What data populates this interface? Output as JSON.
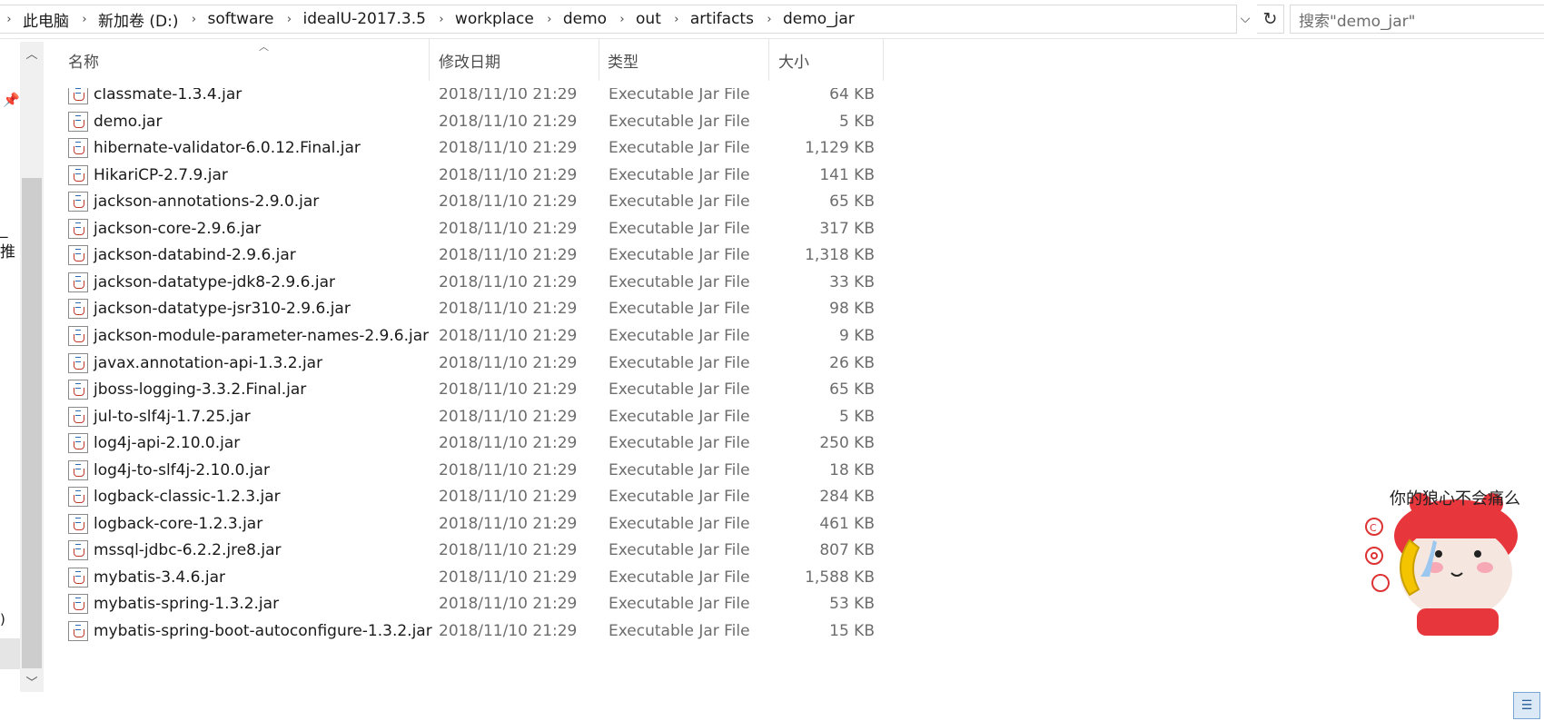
{
  "address": {
    "crumbs": [
      "此电脑",
      "新加卷 (D:)",
      "software",
      "idealU-2017.3.5",
      "workplace",
      "demo",
      "out",
      "artifacts",
      "demo_jar"
    ],
    "separator_icon": "chevron-right-icon"
  },
  "search": {
    "placeholder": "搜索\"demo_jar\""
  },
  "nav": {
    "fragment1": "_推",
    "fragment2": ")"
  },
  "columns": {
    "name": "名称",
    "date": "修改日期",
    "type": "类型",
    "size": "大小"
  },
  "files": [
    {
      "name": "classmate-1.3.4.jar",
      "date": "2018/11/10 21:29",
      "type": "Executable Jar File",
      "size": "64 KB"
    },
    {
      "name": "demo.jar",
      "date": "2018/11/10 21:29",
      "type": "Executable Jar File",
      "size": "5 KB"
    },
    {
      "name": "hibernate-validator-6.0.12.Final.jar",
      "date": "2018/11/10 21:29",
      "type": "Executable Jar File",
      "size": "1,129 KB"
    },
    {
      "name": "HikariCP-2.7.9.jar",
      "date": "2018/11/10 21:29",
      "type": "Executable Jar File",
      "size": "141 KB"
    },
    {
      "name": "jackson-annotations-2.9.0.jar",
      "date": "2018/11/10 21:29",
      "type": "Executable Jar File",
      "size": "65 KB"
    },
    {
      "name": "jackson-core-2.9.6.jar",
      "date": "2018/11/10 21:29",
      "type": "Executable Jar File",
      "size": "317 KB"
    },
    {
      "name": "jackson-databind-2.9.6.jar",
      "date": "2018/11/10 21:29",
      "type": "Executable Jar File",
      "size": "1,318 KB"
    },
    {
      "name": "jackson-datatype-jdk8-2.9.6.jar",
      "date": "2018/11/10 21:29",
      "type": "Executable Jar File",
      "size": "33 KB"
    },
    {
      "name": "jackson-datatype-jsr310-2.9.6.jar",
      "date": "2018/11/10 21:29",
      "type": "Executable Jar File",
      "size": "98 KB"
    },
    {
      "name": "jackson-module-parameter-names-2.9.6.jar",
      "date": "2018/11/10 21:29",
      "type": "Executable Jar File",
      "size": "9 KB"
    },
    {
      "name": "javax.annotation-api-1.3.2.jar",
      "date": "2018/11/10 21:29",
      "type": "Executable Jar File",
      "size": "26 KB"
    },
    {
      "name": "jboss-logging-3.3.2.Final.jar",
      "date": "2018/11/10 21:29",
      "type": "Executable Jar File",
      "size": "65 KB"
    },
    {
      "name": "jul-to-slf4j-1.7.25.jar",
      "date": "2018/11/10 21:29",
      "type": "Executable Jar File",
      "size": "5 KB"
    },
    {
      "name": "log4j-api-2.10.0.jar",
      "date": "2018/11/10 21:29",
      "type": "Executable Jar File",
      "size": "250 KB"
    },
    {
      "name": "log4j-to-slf4j-2.10.0.jar",
      "date": "2018/11/10 21:29",
      "type": "Executable Jar File",
      "size": "18 KB"
    },
    {
      "name": "logback-classic-1.2.3.jar",
      "date": "2018/11/10 21:29",
      "type": "Executable Jar File",
      "size": "284 KB"
    },
    {
      "name": "logback-core-1.2.3.jar",
      "date": "2018/11/10 21:29",
      "type": "Executable Jar File",
      "size": "461 KB"
    },
    {
      "name": "mssql-jdbc-6.2.2.jre8.jar",
      "date": "2018/11/10 21:29",
      "type": "Executable Jar File",
      "size": "807 KB"
    },
    {
      "name": "mybatis-3.4.6.jar",
      "date": "2018/11/10 21:29",
      "type": "Executable Jar File",
      "size": "1,588 KB"
    },
    {
      "name": "mybatis-spring-1.3.2.jar",
      "date": "2018/11/10 21:29",
      "type": "Executable Jar File",
      "size": "53 KB"
    },
    {
      "name": "mybatis-spring-boot-autoconfigure-1.3.2.jar",
      "date": "2018/11/10 21:29",
      "type": "Executable Jar File",
      "size": "15 KB"
    }
  ],
  "sticker": {
    "text": "你的狼心不会痛么"
  },
  "colors": {
    "accent": "#2a5d9a",
    "selection": "#e5e5e5"
  }
}
